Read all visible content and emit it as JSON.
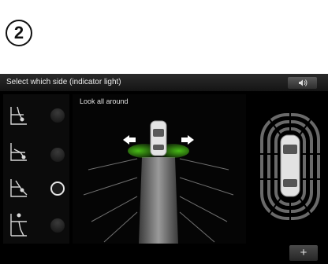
{
  "step": {
    "number": "2"
  },
  "header": {
    "title": "Select which side (indicator light)"
  },
  "buttons": {
    "sound_icon": "speaker-icon",
    "plus_label": "+"
  },
  "center": {
    "label": "Look all around"
  },
  "options": [
    {
      "icon": "parking-diagram-icon",
      "selected": false
    },
    {
      "icon": "parking-diagram-icon",
      "selected": false
    },
    {
      "icon": "parking-diagram-icon",
      "selected": true
    },
    {
      "icon": "parking-diagram-icon",
      "selected": false
    }
  ],
  "colors": {
    "accent_green": "#4fd018",
    "background": "#000000",
    "text": "#e8e8e8"
  }
}
